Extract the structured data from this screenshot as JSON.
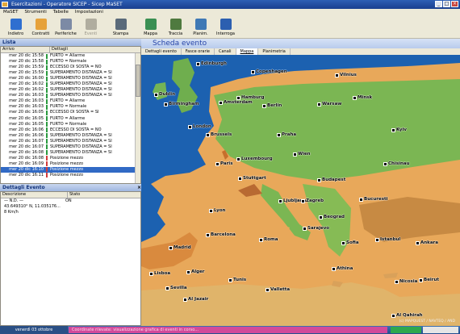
{
  "window": {
    "title": "Esercitazioni - Operatore SICEP - Sicep MaSET"
  },
  "menu": [
    "MaSET",
    "Strumenti",
    "Tabelle",
    "Impostazioni"
  ],
  "toolbar": {
    "buttons": [
      {
        "label": "Indietro",
        "icon": "back-arrow-icon",
        "color": "#2f6fd0"
      },
      {
        "label": "Contratti",
        "icon": "contracts-icon",
        "color": "#e6a23b"
      },
      {
        "label": "Periferiche",
        "icon": "peripherals-icon",
        "color": "#7c8aa5"
      },
      {
        "label": "Eventi",
        "icon": "events-icon",
        "color": "#b0ad9f",
        "disabled": true
      },
      {
        "label": "Stampa",
        "icon": "print-icon",
        "color": "#5a6a7a"
      },
      {
        "label": "Mappa",
        "icon": "map-icon",
        "color": "#3a8f52"
      },
      {
        "label": "Traccia",
        "icon": "track-icon",
        "color": "#4f7a3f"
      },
      {
        "label": "Planim.",
        "icon": "floorplan-icon",
        "color": "#3f79b5"
      },
      {
        "label": "Interroga",
        "icon": "query-icon",
        "color": "#2c5fb0"
      }
    ]
  },
  "list_panel": {
    "title": "Lista",
    "columns": [
      "Arrivo",
      "Dettagli"
    ],
    "rows": [
      {
        "time": "mer 20 dic 15:58",
        "detail": "FURTO = Allarme",
        "marker": "#2a9a3f"
      },
      {
        "time": "mer 20 dic 15:58",
        "detail": "FURTO = Normale",
        "marker": "#2a9a3f"
      },
      {
        "time": "mer 20 dic 15:59",
        "detail": "ECCESSO DI SOSTA = NO",
        "marker": "#2a9a3f"
      },
      {
        "time": "mer 20 dic 15:59",
        "detail": "SUPERAMENTO DISTANZA = SI",
        "marker": "#2a9a3f"
      },
      {
        "time": "mer 20 dic 16:00",
        "detail": "SUPERAMENTO DISTANZA = SI",
        "marker": "#2a9a3f"
      },
      {
        "time": "mer 20 dic 16:02",
        "detail": "SUPERAMENTO DISTANZA = SI",
        "marker": "#2a9a3f"
      },
      {
        "time": "mer 20 dic 16:02",
        "detail": "SUPERAMENTO DISTANZA = SI",
        "marker": "#2a9a3f"
      },
      {
        "time": "mer 20 dic 16:03",
        "detail": "SUPERAMENTO DISTANZA = SI",
        "marker": "#2a9a3f"
      },
      {
        "time": "mer 20 dic 16:03",
        "detail": "FURTO = Allarme",
        "marker": "#2a9a3f"
      },
      {
        "time": "mer 20 dic 16:03",
        "detail": "FURTO = Normale",
        "marker": "#2a9a3f"
      },
      {
        "time": "mer 20 dic 16:05",
        "detail": "ECCESSO DI SOSTA = SI",
        "marker": "#2a9a3f"
      },
      {
        "time": "mer 20 dic 16:05",
        "detail": "FURTO = Allarme",
        "marker": "#2a9a3f"
      },
      {
        "time": "mer 20 dic 16:05",
        "detail": "FURTO = Normale",
        "marker": "#2a9a3f"
      },
      {
        "time": "mer 20 dic 16:06",
        "detail": "ECCESSO DI SOSTA = NO",
        "marker": "#2a9a3f"
      },
      {
        "time": "mer 20 dic 16:06",
        "detail": "SUPERAMENTO DISTANZA = SI",
        "marker": "#2a9a3f"
      },
      {
        "time": "mer 20 dic 16:07",
        "detail": "SUPERAMENTO DISTANZA = SI",
        "marker": "#2a9a3f"
      },
      {
        "time": "mer 20 dic 16:07",
        "detail": "SUPERAMENTO DISTANZA = SI",
        "marker": "#2a9a3f"
      },
      {
        "time": "mer 20 dic 16:08",
        "detail": "SUPERAMENTO DISTANZA = SI",
        "marker": "#2a9a3f"
      },
      {
        "time": "mer 20 dic 16:08",
        "detail": "Posizione mezzo",
        "marker": "#d23a3a"
      },
      {
        "time": "mer 20 dic 16:09",
        "detail": "Posizione mezzo",
        "marker": "#d23a3a"
      },
      {
        "time": "mer 20 dic 16:10",
        "detail": "Posizione mezzo",
        "marker": "#d23a3a",
        "selected": true
      },
      {
        "time": "mer 20 dic 16:11",
        "detail": "Posizione mezzo",
        "marker": "#d23a3a"
      }
    ]
  },
  "detail_panel": {
    "title": "Dettagli Evento",
    "columns": [
      "Descrizione",
      "Stato"
    ],
    "rows": [
      {
        "desc": "— N.D. —",
        "state": "ON"
      },
      {
        "desc": "43.649310° N, 11.035176...",
        "state": ""
      },
      {
        "desc": "8 Km/h",
        "state": ""
      }
    ]
  },
  "main": {
    "title": "Scheda evento",
    "tabs": [
      "Dettagli evento",
      "Fasce orarie",
      "Canali",
      "Mappa",
      "Planimetria"
    ],
    "active_tab": 3,
    "copyright": "(c) MAPQUEST / NAVTEQ / AND"
  },
  "map_cities": [
    "Edinburgh",
    "Copenhagen",
    "Vilnius",
    "Dublin",
    "Birmingham",
    "Amsterdam",
    "Hamburg",
    "Berlin",
    "Warsaw",
    "Minsk",
    "London",
    "Brussels",
    "Praha",
    "Kyiv",
    "Paris",
    "Luxembourg",
    "Stuttgart",
    "Wien",
    "Chisinau",
    "Lyon",
    "Ljubljana",
    "Zagreb",
    "Budapest",
    "Beograd",
    "Bucuresti",
    "Madrid",
    "Barcelona",
    "Roma",
    "Sarajevo",
    "Sofia",
    "Istanbul",
    "Ankara",
    "Lisboa",
    "Sevilla",
    "Tunis",
    "Alger",
    "Valletta",
    "Athina",
    "Nicosia",
    "Beirut",
    "Al Jazair",
    "Al Qahirah"
  ],
  "taskbar": {
    "date": "venerdì 03 ottobre",
    "message": "Coordinate rilevate: visualizzazione grafica di eventi in corso..."
  }
}
